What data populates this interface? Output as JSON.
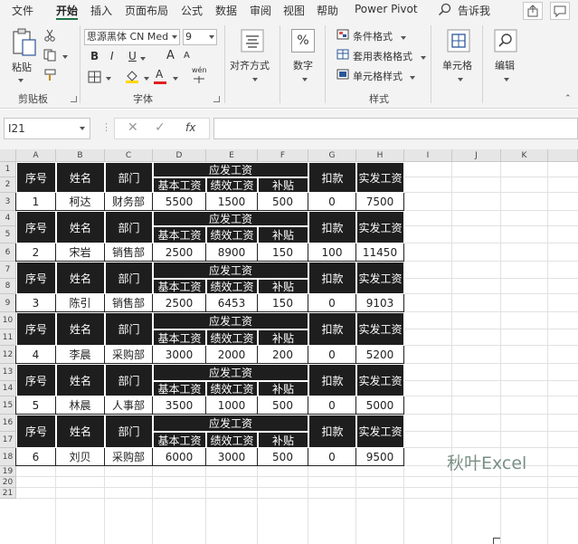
{
  "tabs": [
    "文件",
    "开始",
    "插入",
    "页面布局",
    "公式",
    "数据",
    "审阅",
    "视图",
    "帮助",
    "Power Pivot",
    "告诉我"
  ],
  "active_tab": 1,
  "ribbon": {
    "clipboard": {
      "paste": "粘贴",
      "label": "剪贴板"
    },
    "font": {
      "name": "思源黑体 CN Med",
      "size": "9",
      "bold": "B",
      "italic": "I",
      "underline": "U",
      "grow": "A",
      "shrink": "A",
      "font_color": "A",
      "wen": "wén",
      "label": "字体"
    },
    "alignment": {
      "label": "对齐方式"
    },
    "number": {
      "symbol": "%",
      "label": "数字"
    },
    "styles": {
      "conditional": "条件格式",
      "table": "套用表格格式",
      "cell_styles": "单元格样式",
      "label": "样式"
    },
    "cells": {
      "label": "单元格"
    },
    "editing": {
      "label": "编辑"
    }
  },
  "formula_bar": {
    "name_box": "I21",
    "fx": "fx",
    "value": ""
  },
  "columns": [
    "A",
    "B",
    "C",
    "D",
    "E",
    "F",
    "G",
    "H",
    "I",
    "J",
    "K"
  ],
  "rows": [
    "1",
    "2",
    "3",
    "4",
    "5",
    "6",
    "7",
    "8",
    "9",
    "10",
    "11",
    "12",
    "13",
    "14",
    "15",
    "16",
    "17",
    "18",
    "19",
    "20",
    "21"
  ],
  "headers": {
    "seq": "序号",
    "name": "姓名",
    "dept": "部门",
    "salary": "应发工资",
    "base": "基本工资",
    "perf": "绩效工资",
    "subsidy": "补贴",
    "deduct": "扣款",
    "actual": "实发工资"
  },
  "records": [
    {
      "seq": "1",
      "name": "柯达",
      "dept": "财务部",
      "base": "5500",
      "perf": "1500",
      "subsidy": "500",
      "deduct": "0",
      "actual": "7500"
    },
    {
      "seq": "2",
      "name": "宋岩",
      "dept": "销售部",
      "base": "2500",
      "perf": "8900",
      "subsidy": "150",
      "deduct": "100",
      "actual": "11450"
    },
    {
      "seq": "3",
      "name": "陈引",
      "dept": "销售部",
      "base": "2500",
      "perf": "6453",
      "subsidy": "150",
      "deduct": "0",
      "actual": "9103"
    },
    {
      "seq": "4",
      "name": "李晨",
      "dept": "采购部",
      "base": "3000",
      "perf": "2000",
      "subsidy": "200",
      "deduct": "0",
      "actual": "5200"
    },
    {
      "seq": "5",
      "name": "林晨",
      "dept": "人事部",
      "base": "3500",
      "perf": "1000",
      "subsidy": "500",
      "deduct": "0",
      "actual": "5000"
    },
    {
      "seq": "6",
      "name": "刘贝",
      "dept": "采购部",
      "base": "6000",
      "perf": "3000",
      "subsidy": "500",
      "deduct": "0",
      "actual": "9500"
    }
  ],
  "watermark": "秋叶Excel",
  "colors": {
    "accent": "#217346",
    "header_fill": "#1e1e1e"
  }
}
